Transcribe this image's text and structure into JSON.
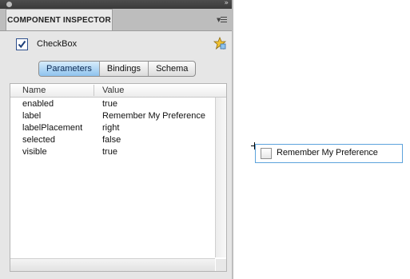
{
  "panel": {
    "title": "COMPONENT INSPECTOR",
    "component_name": "CheckBox",
    "component_checked": true,
    "tabs": [
      "Parameters",
      "Bindings",
      "Schema"
    ],
    "active_tab": "Parameters",
    "columns": {
      "name": "Name",
      "value": "Value"
    },
    "rows": [
      {
        "name": "enabled",
        "value": "true"
      },
      {
        "name": "label",
        "value": "Remember My Preference"
      },
      {
        "name": "labelPlacement",
        "value": "right"
      },
      {
        "name": "selected",
        "value": "false"
      },
      {
        "name": "visible",
        "value": "true"
      }
    ]
  },
  "stage": {
    "checkbox_label": "Remember My Preference",
    "checkbox_checked": false
  },
  "colors": {
    "accent_tab": "#8fc3ee",
    "selection_border": "#5da3dc"
  },
  "icons": {
    "collapse": "double-chevron-right-icon",
    "panel_menu": "panel-menu-icon",
    "component_checkbox": "checkbox-checked-icon",
    "component": "star-component-icon",
    "registration": "crosshair-icon"
  }
}
